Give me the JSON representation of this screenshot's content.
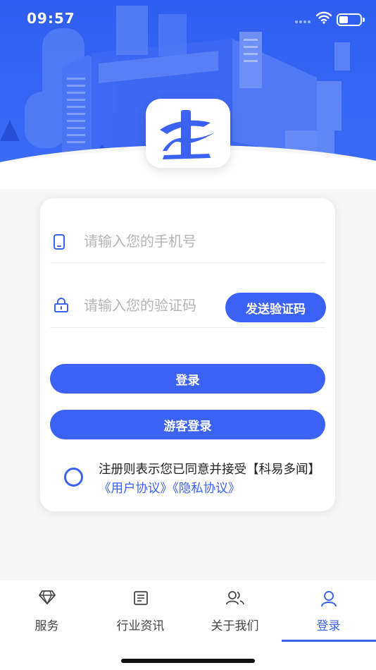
{
  "status_bar": {
    "time": "09:57"
  },
  "login": {
    "phone_placeholder": "请输入您的手机号",
    "code_placeholder": "请输入您的验证码",
    "send_code_label": "发送验证码",
    "login_label": "登录",
    "guest_login_label": "游客登录"
  },
  "agreement": {
    "text": "注册则表示您已同意并接受【科易多闻】",
    "user_agreement": "《用户协议》",
    "privacy_agreement": "《隐私协议》"
  },
  "tabs": [
    {
      "label": "服务",
      "icon": "diamond-icon"
    },
    {
      "label": "行业资讯",
      "icon": "news-icon"
    },
    {
      "label": "关于我们",
      "icon": "people-icon"
    },
    {
      "label": "登录",
      "icon": "user-icon"
    }
  ],
  "active_tab": 3,
  "colors": {
    "accent": "#3b62f2",
    "hero": "#2f5ef0"
  }
}
